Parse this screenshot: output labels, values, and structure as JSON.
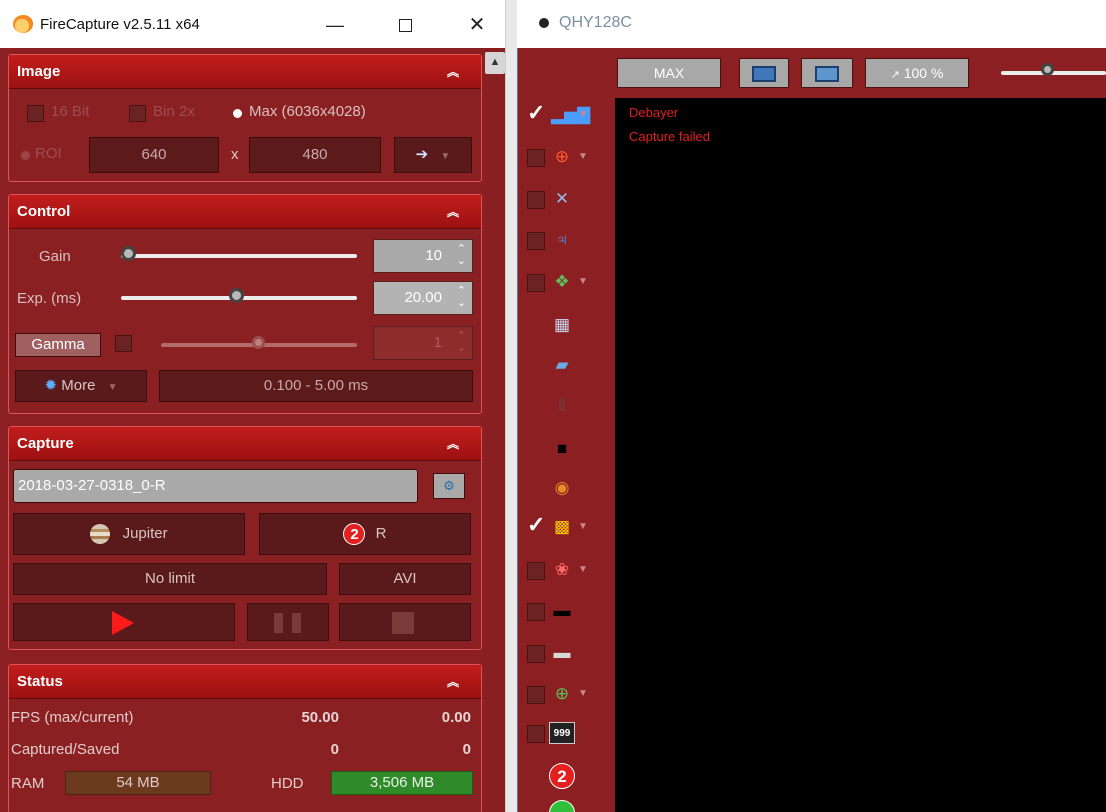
{
  "main_window": {
    "title": "FireCapture v2.5.11  x64",
    "minimize": "—",
    "close": "✕"
  },
  "image": {
    "header": "Image",
    "bit16_label": "16 Bit",
    "bin_label": "Bin 2x",
    "max_label": "Max (6036x4028)",
    "roi_label": "ROI",
    "roi_width": "640",
    "x_sep": "x",
    "roi_height": "480"
  },
  "control": {
    "header": "Control",
    "gain_label": "Gain",
    "gain_value": "10",
    "gain_level": 0.0,
    "exp_label": "Exp. (ms)",
    "exp_value": "20.00",
    "exp_level": 0.49,
    "gamma_label": "Gamma",
    "gamma_value": "1",
    "gamma_level": 0.5,
    "more_label": "More",
    "range_label": "0.100 - 5.00 ms"
  },
  "capture": {
    "header": "Capture",
    "filename": "2018-03-27-0318_0-R",
    "object_label": "Jupiter",
    "filter_badge": "2",
    "filter_label": "R",
    "limit_label": "No limit",
    "format_label": "AVI"
  },
  "status": {
    "header": "Status",
    "fps_label": "FPS (max/current)",
    "fps_max": "50.00",
    "fps_current": "0.00",
    "captured_label": "Captured/Saved",
    "captured": "0",
    "saved": "0",
    "ram_label": "RAM",
    "ram_value": "54 MB",
    "hdd_label": "HDD",
    "hdd_value": "3,506 MB"
  },
  "preview_window": {
    "title": "QHY128C",
    "max_label": "MAX",
    "zoom_label": "100 %",
    "debayer_text": "Debayer",
    "error_text": "Capture failed",
    "tool_badge": "999",
    "tool_number": "2"
  },
  "colors": {
    "panel_bg": "#8c1f21",
    "header_red": "#c21d1c",
    "error_red": "#e02020",
    "hdd_green": "#2f8a2a"
  }
}
